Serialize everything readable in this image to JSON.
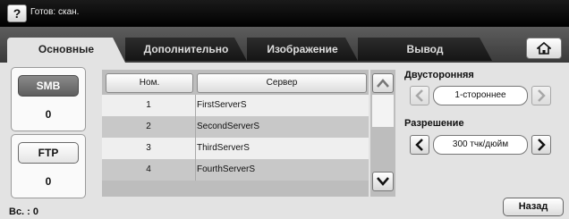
{
  "header": {
    "help_label": "?",
    "status": "Готов: скан."
  },
  "tabs": [
    {
      "label": "Основные",
      "active": true
    },
    {
      "label": "Дополнительно",
      "active": false
    },
    {
      "label": "Изображение",
      "active": false
    },
    {
      "label": "Вывод",
      "active": false
    }
  ],
  "protocols": [
    {
      "label": "SMB",
      "count": "0",
      "selected": true
    },
    {
      "label": "FTP",
      "count": "0",
      "selected": false
    }
  ],
  "table": {
    "columns": [
      "Ном.",
      "Сервер"
    ],
    "rows": [
      {
        "num": "1",
        "server": "FirstServerS"
      },
      {
        "num": "2",
        "server": "SecondServerS"
      },
      {
        "num": "3",
        "server": "ThirdServerS"
      },
      {
        "num": "4",
        "server": "FourthServerS"
      }
    ]
  },
  "options": {
    "duplex": {
      "label": "Двусторонняя",
      "value": "1-стороннее"
    },
    "resolution": {
      "label": "Разрешение",
      "value": "300 тчк/дюйм"
    }
  },
  "footer": {
    "summary": "Вс. : 0",
    "back_label": "Назад"
  },
  "icons": {
    "home": "home-icon",
    "help": "question-icon",
    "scroll_up": "chevron-up-icon",
    "scroll_down": "chevron-down-icon",
    "prev": "chevron-left-icon",
    "next": "chevron-right-icon"
  },
  "colors": {
    "selected_button": "#6e6e6e",
    "panel_bg": "#e3e3e3",
    "topbar_bg": "#000000"
  }
}
